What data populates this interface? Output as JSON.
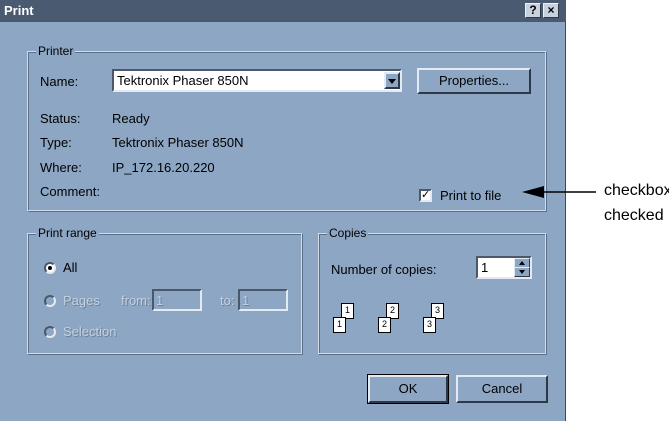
{
  "dialog": {
    "title": "Print",
    "help_button": "?",
    "close_button": "×"
  },
  "printer": {
    "legend": "Printer",
    "name_label": "Name:",
    "name_value": "Tektronix Phaser 850N",
    "properties_button": "Properties...",
    "status_label": "Status:",
    "status_value": "Ready",
    "type_label": "Type:",
    "type_value": "Tektronix Phaser 850N",
    "where_label": "Where:",
    "where_value": "IP_172.16.20.220",
    "comment_label": "Comment:",
    "print_to_file_label": "Print to file",
    "print_to_file_checked": true,
    "check_mark": "✓"
  },
  "print_range": {
    "legend": "Print range",
    "all_label": "All",
    "pages_label": "Pages",
    "from_label": "from:",
    "from_value": "1",
    "to_label": "to:",
    "to_value": "1",
    "selection_label": "Selection",
    "selected": "All"
  },
  "copies": {
    "legend": "Copies",
    "number_label": "Number of copies:",
    "number_value": "1",
    "collate_pages": [
      "1",
      "1",
      "2",
      "2",
      "3",
      "3"
    ]
  },
  "buttons": {
    "ok": "OK",
    "cancel": "Cancel"
  },
  "annotation": {
    "line1": "checkbox",
    "line2": "checked"
  }
}
